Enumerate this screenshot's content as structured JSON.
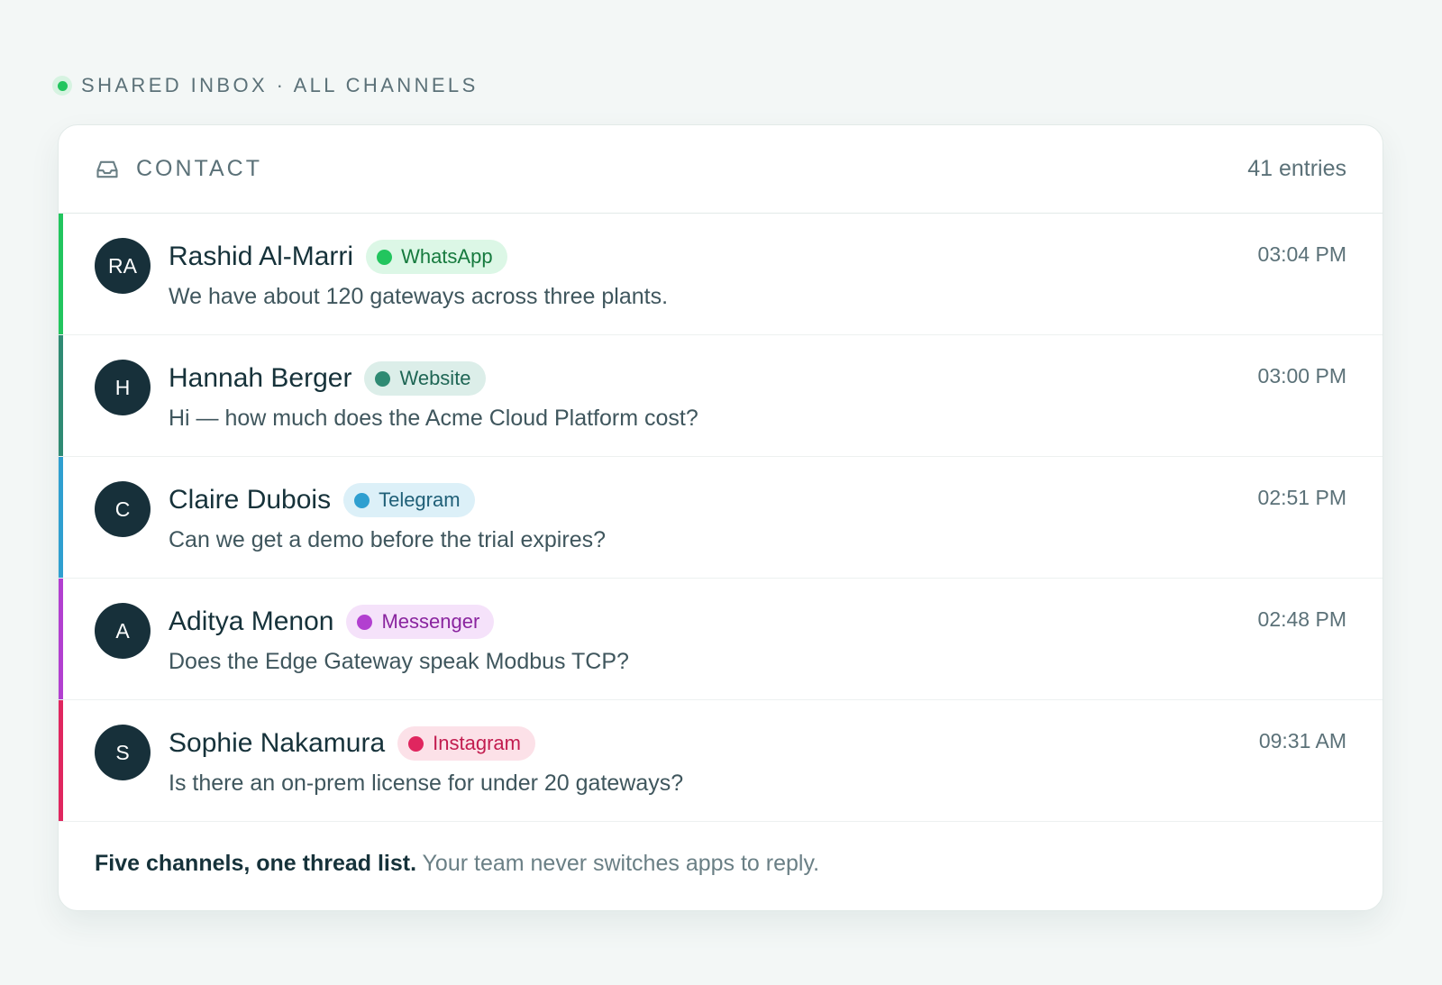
{
  "eyebrow": {
    "text": "SHARED INBOX · ALL CHANNELS"
  },
  "header": {
    "title": "CONTACT",
    "entries": "41 entries",
    "icon": "inbox-icon"
  },
  "threads": [
    {
      "initials": "RA",
      "name": "Rashid Al-Marri",
      "channel": "WhatsApp",
      "time": "03:04 PM",
      "message": "We have about 120 gateways across three plants.",
      "accent": "#22c55e",
      "pill_bg": "#dcf7e6",
      "pill_fg": "#167a3e"
    },
    {
      "initials": "H",
      "name": "Hannah Berger",
      "channel": "Website",
      "time": "03:00 PM",
      "message": "Hi — how much does the Acme Cloud Platform cost?",
      "accent": "#2f8a73",
      "pill_bg": "#dceee9",
      "pill_fg": "#1f6655"
    },
    {
      "initials": "C",
      "name": "Claire Dubois",
      "channel": "Telegram",
      "time": "02:51 PM",
      "message": "Can we get a demo before the trial expires?",
      "accent": "#2f9fd0",
      "pill_bg": "#dcf0f8",
      "pill_fg": "#1f5f77"
    },
    {
      "initials": "A",
      "name": "Aditya Menon",
      "channel": "Messenger",
      "time": "02:48 PM",
      "message": "Does the Edge Gateway speak Modbus TCP?",
      "accent": "#b23fd0",
      "pill_bg": "#f5e2fa",
      "pill_fg": "#8a259f"
    },
    {
      "initials": "S",
      "name": "Sophie Nakamura",
      "channel": "Instagram",
      "time": "09:31 AM",
      "message": "Is there an on-prem license for under 20 gateways?",
      "accent": "#e0265f",
      "pill_bg": "#fce1e8",
      "pill_fg": "#c21c4f"
    }
  ],
  "footer": {
    "bold": "Five channels, one thread list.",
    "text": " Your team never switches apps to reply."
  }
}
